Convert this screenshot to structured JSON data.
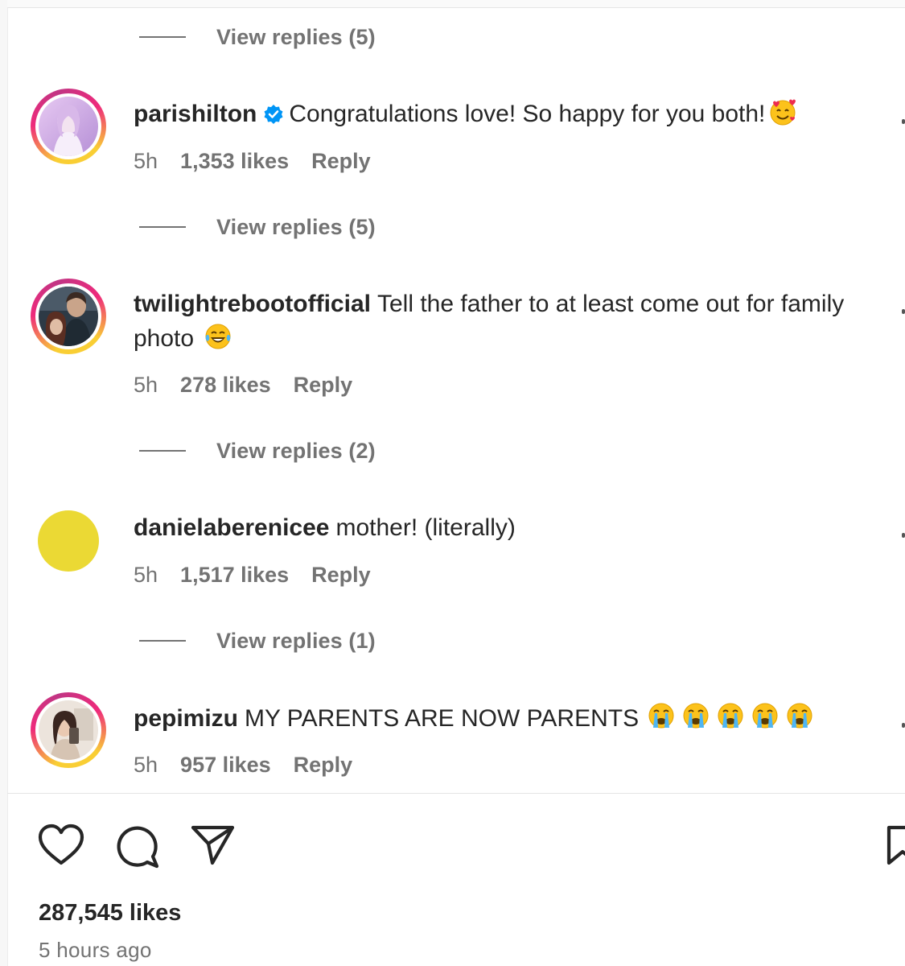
{
  "replies_toggles": [
    {
      "label": "View replies (5)"
    },
    {
      "label": "View replies (5)"
    },
    {
      "label": "View replies (2)"
    },
    {
      "label": "View replies (1)"
    }
  ],
  "comments": [
    {
      "username": "parishilton",
      "verified": true,
      "text": "Congratulations love! So happy for you both!",
      "emoji": "smiling-face-with-hearts",
      "time": "5h",
      "likes": "1,353 likes",
      "reply": "Reply"
    },
    {
      "username": "twilightrebootofficial",
      "text": "Tell the father to at least come out for family photo",
      "emoji": "face-with-tears-of-joy",
      "time": "5h",
      "likes": "278 likes",
      "reply": "Reply"
    },
    {
      "username": "danielaberenicee",
      "text": "mother! (literally)",
      "time": "5h",
      "likes": "1,517 likes",
      "reply": "Reply"
    },
    {
      "username": "pepimizu",
      "text": "MY PARENTS ARE NOW PARENTS",
      "emoji": "loudly-crying-face x5",
      "time": "5h",
      "likes": "957 likes",
      "reply": "Reply"
    }
  ],
  "actions": [
    "heart-icon",
    "comment-icon",
    "share-icon",
    "save-icon"
  ],
  "post": {
    "likes": "287,545 likes",
    "time_ago": "5 hours ago"
  },
  "colors": {
    "text": "#262626",
    "secondary": "#737373",
    "verified": "#0095f6",
    "avatar_yellow": "#ebd934"
  }
}
